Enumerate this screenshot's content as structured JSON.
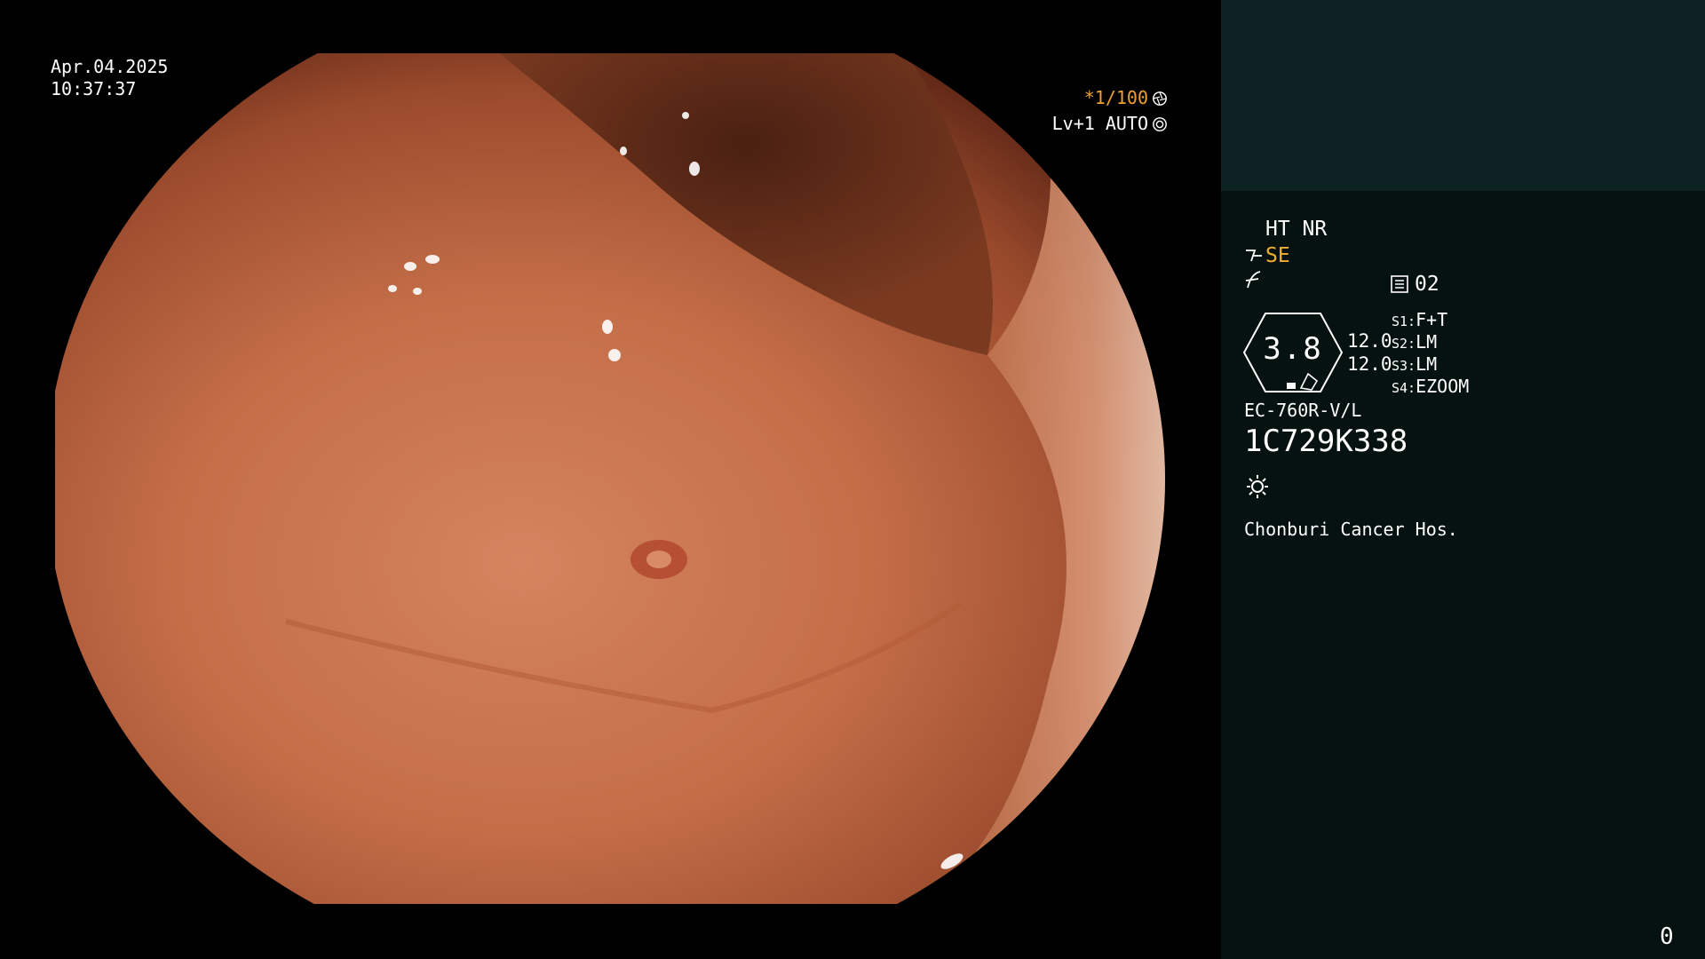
{
  "overlay": {
    "date": "Apr.04.2025",
    "time": "10:37:37",
    "shutter": "*1/100",
    "level": "Lv+1 AUTO"
  },
  "panel": {
    "ht_nr": "HT NR",
    "se": "SE",
    "memory": "02",
    "gauge_value": "3.8",
    "gauge_a": "12.0",
    "gauge_b": "12.0",
    "switches": [
      {
        "key": "S1:",
        "value": "F+T"
      },
      {
        "key": "S2:",
        "value": "LM"
      },
      {
        "key": "S3:",
        "value": "LM"
      },
      {
        "key": "S4:",
        "value": "EZOOM"
      }
    ],
    "scope_model": "EC-760R-V/L",
    "scope_serial": "1C729K338",
    "hospital": "Chonburi Cancer Hos.",
    "counter": "0"
  },
  "colors": {
    "accent_orange": "#f0a030",
    "panel_bg": "#061210",
    "thumb_bg": "#0d2222",
    "tissue": "#c8704a"
  },
  "icons": {
    "shutter": "aperture-icon",
    "level": "iris-icon",
    "se": "scope-tip-icon",
    "f": "filter-icon",
    "memory": "memory-card-icon",
    "light": "light-source-icon"
  }
}
